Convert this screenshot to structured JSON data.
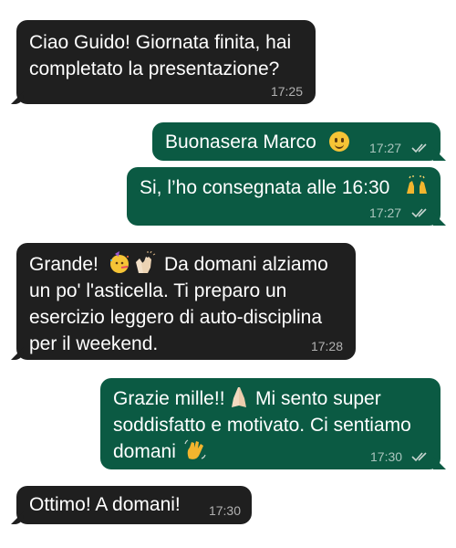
{
  "chat": {
    "messages": [
      {
        "direction": "incoming",
        "lines": [
          "Ciao Guido! Giornata finita, hai",
          "completato la presentazione?"
        ],
        "time": "17:25"
      },
      {
        "direction": "outgoing",
        "lines": [
          "Buonasera Marco"
        ],
        "emoji": "slightly-smiling-face",
        "time": "17:27",
        "status": "read"
      },
      {
        "direction": "outgoing",
        "lines": [
          "Si, l’ho consegnata alle 16:30"
        ],
        "emoji": "raising-hands",
        "time": "17:27",
        "status": "read"
      },
      {
        "direction": "incoming",
        "lines": [
          "Grande!",
          "Da domani alziamo",
          "un po' l'asticella. Ti preparo un",
          "esercizio leggero di auto-disciplina",
          "per il weekend."
        ],
        "emoji": [
          "partying-face",
          "clapping-hands"
        ],
        "time": "17:28"
      },
      {
        "direction": "outgoing",
        "lines": [
          "Grazie mille!!",
          "Mi sento super",
          "soddisfatto e motivato. Ci sentiamo",
          "domani"
        ],
        "emoji": [
          "folded-hands",
          "waving-hand"
        ],
        "time": "17:30",
        "status": "read"
      },
      {
        "direction": "incoming",
        "lines": [
          "Ottimo! A domani!"
        ],
        "time": "17:30"
      }
    ]
  },
  "colors": {
    "incoming_bubble": "#1f1f1f",
    "outgoing_bubble": "#0b5a43",
    "background": "#ffffff",
    "read_ticks": "#c9d6d1"
  }
}
